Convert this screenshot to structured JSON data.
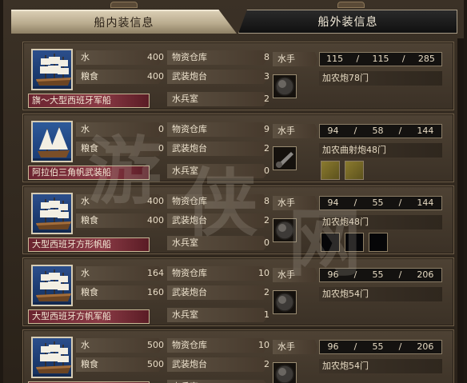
{
  "tabs": {
    "inner": "船内装信息",
    "outer": "船外装信息"
  },
  "labels": {
    "water": "水",
    "food": "粮食",
    "warehouse": "物资仓库",
    "battery": "武装炮台",
    "marines": "水兵室",
    "crew": "水手"
  },
  "ships": [
    {
      "name": "旗～大型西班牙军船",
      "water": "400",
      "food": "400",
      "warehouse": "8",
      "battery": "3",
      "marines": "2",
      "crew": [
        "115",
        "/",
        "115",
        "/",
        "285"
      ],
      "guns": "加农炮78门",
      "portrait_icon": "galleon-icon",
      "slots": []
    },
    {
      "name": "阿拉伯三角帆武装船",
      "water": "0",
      "food": "0",
      "warehouse": "9",
      "battery": "2",
      "marines": "0",
      "crew": [
        "94",
        "/",
        "58",
        "/",
        "144"
      ],
      "guns": "加农曲射炮48门",
      "portrait_icon": "lateen-ship-icon",
      "slots": [
        "item",
        "item"
      ]
    },
    {
      "name": "大型西班牙方形帆船",
      "water": "400",
      "food": "400",
      "warehouse": "8",
      "battery": "2",
      "marines": "0",
      "crew": [
        "94",
        "/",
        "55",
        "/",
        "144"
      ],
      "guns": "加农炮48门",
      "portrait_icon": "galleon-icon",
      "slots": [
        "empty",
        "empty",
        "empty"
      ]
    },
    {
      "name": "大型西班牙方帆军船",
      "water": "164",
      "food": "160",
      "warehouse": "10",
      "battery": "2",
      "marines": "1",
      "crew": [
        "96",
        "/",
        "55",
        "/",
        "206"
      ],
      "guns": "加农炮54门",
      "portrait_icon": "galleon-icon",
      "slots": []
    },
    {
      "name": "",
      "water": "500",
      "food": "500",
      "warehouse": "10",
      "battery": "2",
      "marines": "",
      "crew": [
        "96",
        "/",
        "55",
        "/",
        "206"
      ],
      "guns": "加农炮54门",
      "portrait_icon": "galleon-icon",
      "slots": []
    }
  ],
  "colors": {
    "name_bar": "#7a2c38",
    "panel": "#4e4234",
    "crew_box": "#141210"
  }
}
